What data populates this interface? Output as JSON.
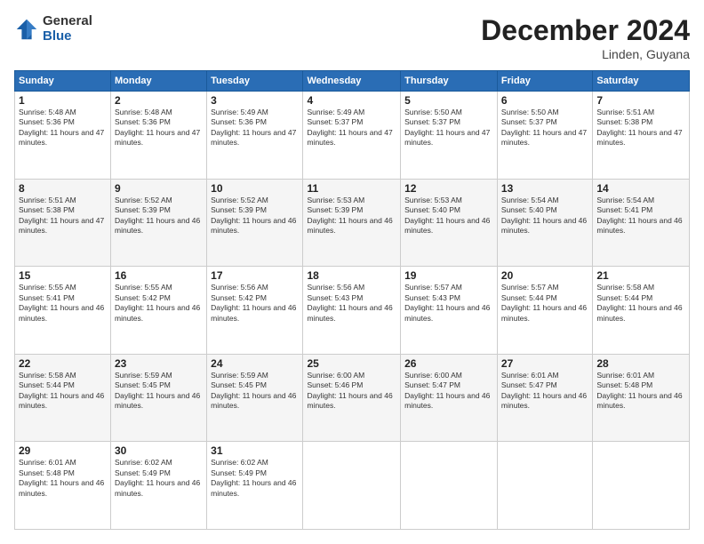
{
  "logo": {
    "general": "General",
    "blue": "Blue"
  },
  "header": {
    "month": "December 2024",
    "location": "Linden, Guyana"
  },
  "days_of_week": [
    "Sunday",
    "Monday",
    "Tuesday",
    "Wednesday",
    "Thursday",
    "Friday",
    "Saturday"
  ],
  "weeks": [
    [
      {
        "day": 1,
        "sunrise": "5:48 AM",
        "sunset": "5:36 PM",
        "daylight": "11 hours and 47 minutes."
      },
      {
        "day": 2,
        "sunrise": "5:48 AM",
        "sunset": "5:36 PM",
        "daylight": "11 hours and 47 minutes."
      },
      {
        "day": 3,
        "sunrise": "5:49 AM",
        "sunset": "5:36 PM",
        "daylight": "11 hours and 47 minutes."
      },
      {
        "day": 4,
        "sunrise": "5:49 AM",
        "sunset": "5:37 PM",
        "daylight": "11 hours and 47 minutes."
      },
      {
        "day": 5,
        "sunrise": "5:50 AM",
        "sunset": "5:37 PM",
        "daylight": "11 hours and 47 minutes."
      },
      {
        "day": 6,
        "sunrise": "5:50 AM",
        "sunset": "5:37 PM",
        "daylight": "11 hours and 47 minutes."
      },
      {
        "day": 7,
        "sunrise": "5:51 AM",
        "sunset": "5:38 PM",
        "daylight": "11 hours and 47 minutes."
      }
    ],
    [
      {
        "day": 8,
        "sunrise": "5:51 AM",
        "sunset": "5:38 PM",
        "daylight": "11 hours and 47 minutes."
      },
      {
        "day": 9,
        "sunrise": "5:52 AM",
        "sunset": "5:39 PM",
        "daylight": "11 hours and 46 minutes."
      },
      {
        "day": 10,
        "sunrise": "5:52 AM",
        "sunset": "5:39 PM",
        "daylight": "11 hours and 46 minutes."
      },
      {
        "day": 11,
        "sunrise": "5:53 AM",
        "sunset": "5:39 PM",
        "daylight": "11 hours and 46 minutes."
      },
      {
        "day": 12,
        "sunrise": "5:53 AM",
        "sunset": "5:40 PM",
        "daylight": "11 hours and 46 minutes."
      },
      {
        "day": 13,
        "sunrise": "5:54 AM",
        "sunset": "5:40 PM",
        "daylight": "11 hours and 46 minutes."
      },
      {
        "day": 14,
        "sunrise": "5:54 AM",
        "sunset": "5:41 PM",
        "daylight": "11 hours and 46 minutes."
      }
    ],
    [
      {
        "day": 15,
        "sunrise": "5:55 AM",
        "sunset": "5:41 PM",
        "daylight": "11 hours and 46 minutes."
      },
      {
        "day": 16,
        "sunrise": "5:55 AM",
        "sunset": "5:42 PM",
        "daylight": "11 hours and 46 minutes."
      },
      {
        "day": 17,
        "sunrise": "5:56 AM",
        "sunset": "5:42 PM",
        "daylight": "11 hours and 46 minutes."
      },
      {
        "day": 18,
        "sunrise": "5:56 AM",
        "sunset": "5:43 PM",
        "daylight": "11 hours and 46 minutes."
      },
      {
        "day": 19,
        "sunrise": "5:57 AM",
        "sunset": "5:43 PM",
        "daylight": "11 hours and 46 minutes."
      },
      {
        "day": 20,
        "sunrise": "5:57 AM",
        "sunset": "5:44 PM",
        "daylight": "11 hours and 46 minutes."
      },
      {
        "day": 21,
        "sunrise": "5:58 AM",
        "sunset": "5:44 PM",
        "daylight": "11 hours and 46 minutes."
      }
    ],
    [
      {
        "day": 22,
        "sunrise": "5:58 AM",
        "sunset": "5:44 PM",
        "daylight": "11 hours and 46 minutes."
      },
      {
        "day": 23,
        "sunrise": "5:59 AM",
        "sunset": "5:45 PM",
        "daylight": "11 hours and 46 minutes."
      },
      {
        "day": 24,
        "sunrise": "5:59 AM",
        "sunset": "5:45 PM",
        "daylight": "11 hours and 46 minutes."
      },
      {
        "day": 25,
        "sunrise": "6:00 AM",
        "sunset": "5:46 PM",
        "daylight": "11 hours and 46 minutes."
      },
      {
        "day": 26,
        "sunrise": "6:00 AM",
        "sunset": "5:47 PM",
        "daylight": "11 hours and 46 minutes."
      },
      {
        "day": 27,
        "sunrise": "6:01 AM",
        "sunset": "5:47 PM",
        "daylight": "11 hours and 46 minutes."
      },
      {
        "day": 28,
        "sunrise": "6:01 AM",
        "sunset": "5:48 PM",
        "daylight": "11 hours and 46 minutes."
      }
    ],
    [
      {
        "day": 29,
        "sunrise": "6:01 AM",
        "sunset": "5:48 PM",
        "daylight": "11 hours and 46 minutes."
      },
      {
        "day": 30,
        "sunrise": "6:02 AM",
        "sunset": "5:49 PM",
        "daylight": "11 hours and 46 minutes."
      },
      {
        "day": 31,
        "sunrise": "6:02 AM",
        "sunset": "5:49 PM",
        "daylight": "11 hours and 46 minutes."
      },
      null,
      null,
      null,
      null
    ]
  ]
}
